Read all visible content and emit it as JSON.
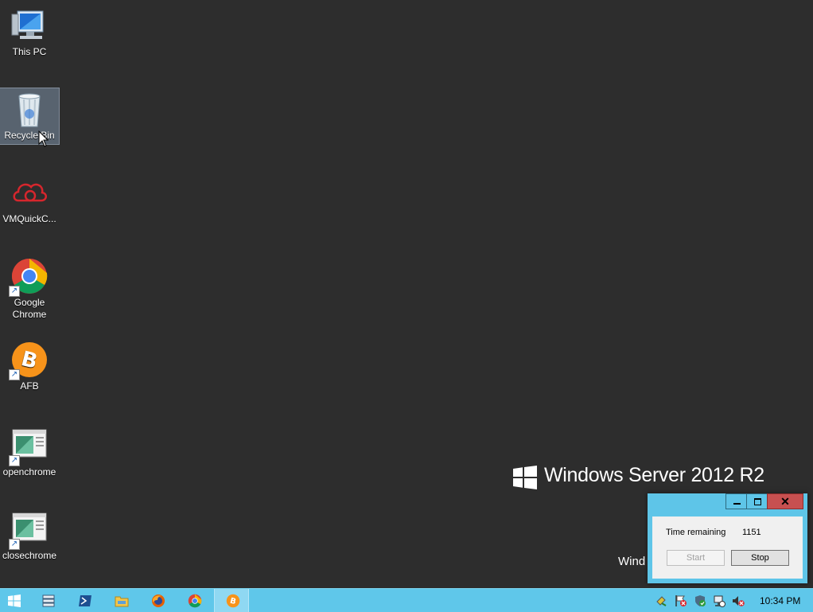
{
  "desktop": {
    "icons": [
      {
        "label": "This PC",
        "name": "this-pc-icon"
      },
      {
        "label": "Recycle Bin",
        "name": "recycle-bin-icon"
      },
      {
        "label": "VMQuickC...",
        "name": "vmquickconfig-icon"
      },
      {
        "label": "Google Chrome",
        "name": "google-chrome-icon"
      },
      {
        "label": "AFB",
        "name": "bitcoin-icon"
      },
      {
        "label": "openchrome",
        "name": "openchrome-icon"
      },
      {
        "label": "closechrome",
        "name": "closechrome-icon"
      }
    ],
    "watermark": "Windows Server 2012 R2",
    "build_text": "Wind"
  },
  "timer_window": {
    "time_label": "Time remaining",
    "time_value": "1151",
    "start_label": "Start",
    "stop_label": "Stop"
  },
  "taskbar": {
    "buttons": [
      "windows-start-icon",
      "server-manager-icon",
      "powershell-icon",
      "file-explorer-icon",
      "firefox-icon",
      "chrome-icon",
      "bitcoin-icon"
    ],
    "tray_icons": [
      "usb-icon",
      "flag-icon",
      "shield-icon",
      "network-icon",
      "volume-muted-icon"
    ],
    "clock": "10:34 PM"
  },
  "colors": {
    "desktop_bg": "#2d2d2d",
    "taskbar": "#5fc7ea",
    "close_button": "#c75050"
  }
}
